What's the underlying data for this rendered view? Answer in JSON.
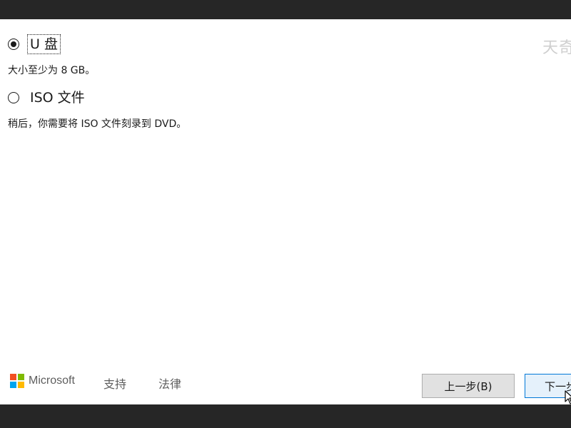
{
  "watermark": "天奇",
  "options": [
    {
      "label": "U 盘",
      "description": "大小至少为 8 GB。",
      "selected": true
    },
    {
      "label": "ISO 文件",
      "description": "稍后，你需要将 ISO 文件刻录到 DVD。",
      "selected": false
    }
  ],
  "footer": {
    "brand": "Microsoft",
    "support_link": "支持",
    "legal_link": "法律"
  },
  "buttons": {
    "back": "上一步(B)",
    "next": "下一步"
  },
  "colors": {
    "ms_red": "#f25022",
    "ms_green": "#7fba00",
    "ms_blue": "#00a4ef",
    "ms_yellow": "#ffb900",
    "next_border": "#0078d7"
  }
}
